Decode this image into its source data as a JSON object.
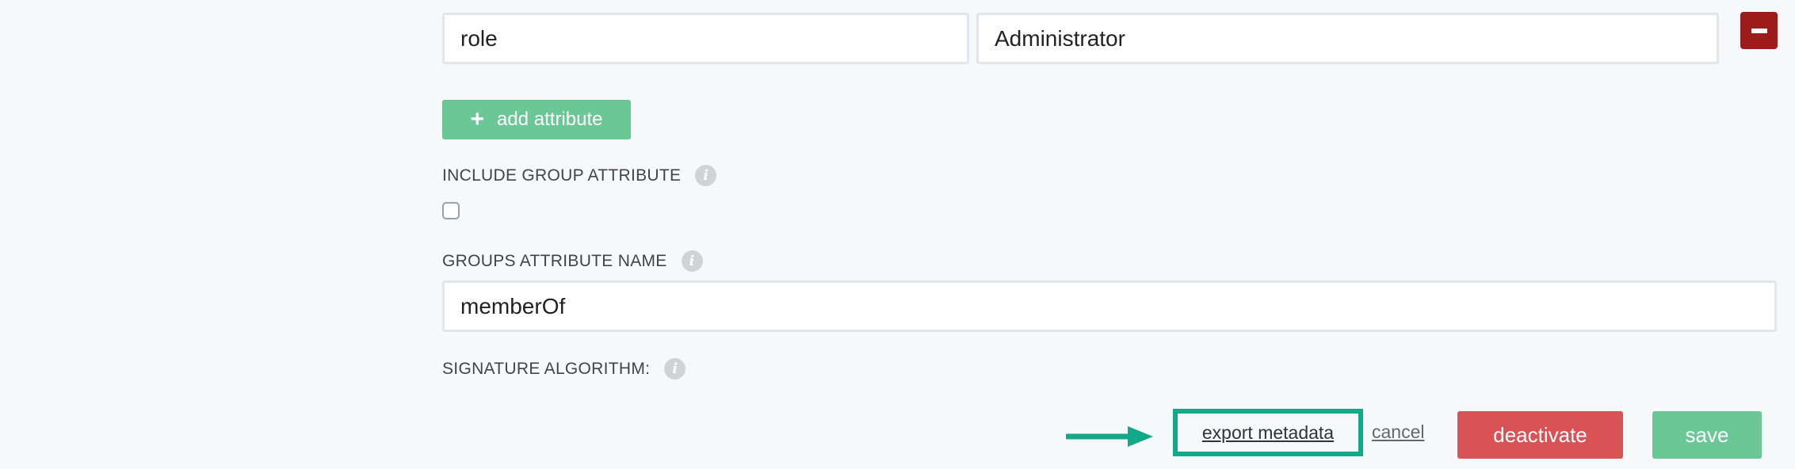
{
  "attribute_row": {
    "name_value": "role",
    "value_value": "Administrator",
    "remove_icon": "minus-icon"
  },
  "add_attribute": {
    "label": "add attribute",
    "icon": "plus-icon"
  },
  "include_group_attribute": {
    "label": "INCLUDE GROUP ATTRIBUTE",
    "checked": false,
    "info_icon": "info-icon"
  },
  "groups_attribute_name": {
    "label": "GROUPS ATTRIBUTE NAME",
    "value": "memberOf",
    "info_icon": "info-icon"
  },
  "signature_algorithm": {
    "label": "SIGNATURE ALGORITHM:",
    "info_icon": "info-icon"
  },
  "footer": {
    "export_metadata": "export metadata",
    "cancel": "cancel",
    "deactivate": "deactivate",
    "save": "save"
  },
  "colors": {
    "accent_green": "#6cc796",
    "danger_red": "#d95356",
    "remove_red": "#9c1c1c",
    "highlight_teal": "#12a88a"
  }
}
